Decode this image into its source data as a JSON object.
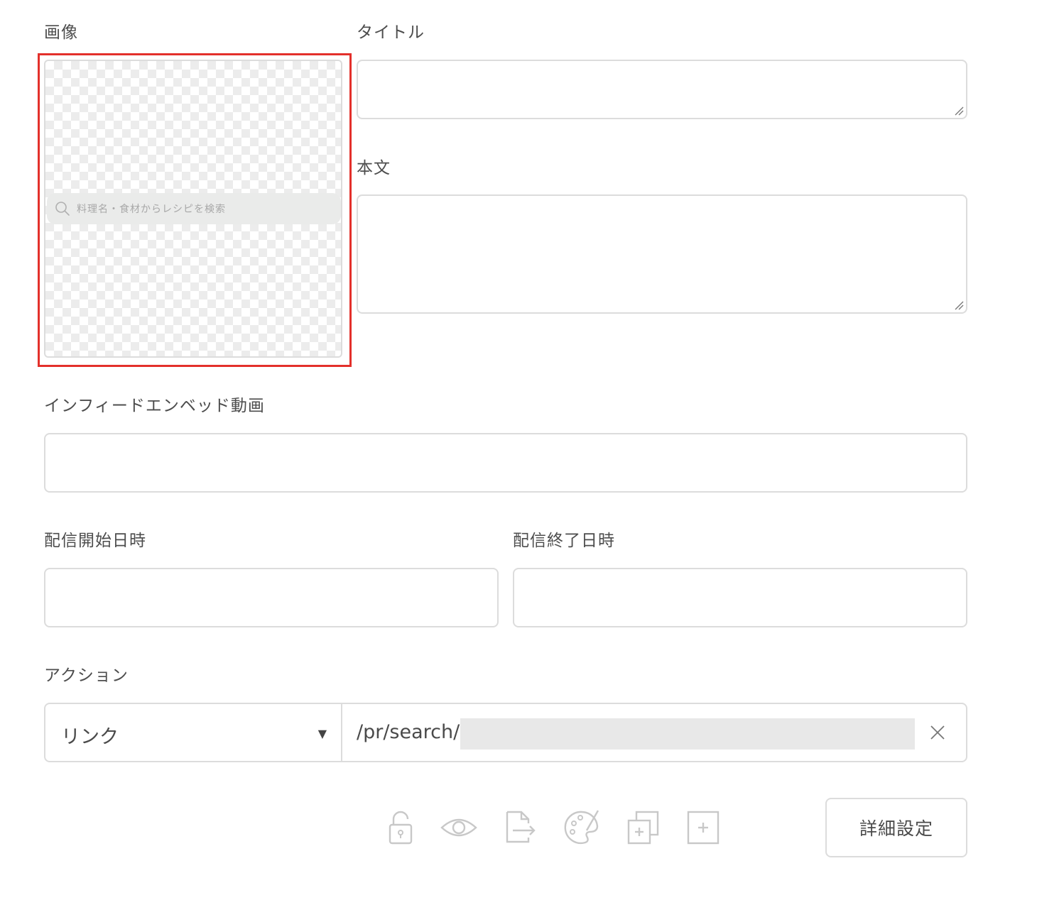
{
  "labels": {
    "image": "画像",
    "title": "タイトル",
    "body": "本文",
    "infeed_video": "インフィードエンベッド動画",
    "start": "配信開始日時",
    "end": "配信終了日時",
    "action": "アクション"
  },
  "image_preview": {
    "search_placeholder": "料理名・食材からレシピを検索"
  },
  "fields": {
    "title_value": "",
    "body_value": "",
    "infeed_video_value": "",
    "start_value": "",
    "end_value": ""
  },
  "action": {
    "type": "リンク",
    "url": "/pr/search/"
  },
  "toolbar": {
    "icons": [
      "lock-icon",
      "eye-icon",
      "export-icon",
      "palette-icon",
      "duplicate-icon",
      "add-icon"
    ],
    "detail_label": "詳細設定"
  },
  "colors": {
    "highlight": "#e3302b",
    "border": "#dcdcdc",
    "icon": "#c8c8c8"
  }
}
